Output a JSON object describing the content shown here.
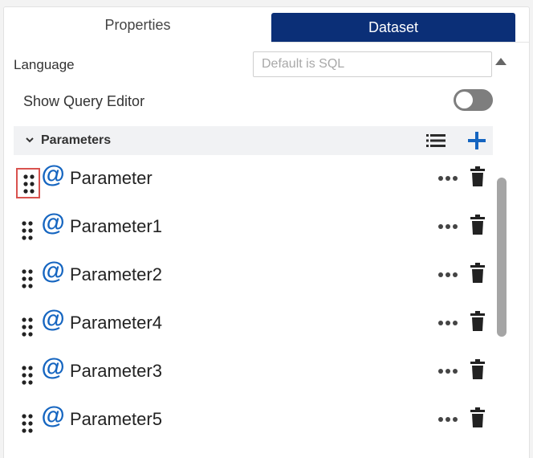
{
  "tabs": {
    "properties": "Properties",
    "dataset": "Dataset"
  },
  "language": {
    "label": "Language",
    "placeholder": "Default is SQL"
  },
  "query_editor": {
    "label": "Show Query Editor",
    "enabled": false
  },
  "parameters": {
    "title": "Parameters",
    "items": [
      {
        "name": "Parameter"
      },
      {
        "name": "Parameter1"
      },
      {
        "name": "Parameter2"
      },
      {
        "name": "Parameter4"
      },
      {
        "name": "Parameter3"
      },
      {
        "name": "Parameter5"
      }
    ]
  },
  "icons": {
    "at": "@",
    "drag": "drag-handle-icon",
    "more": "more-options-icon",
    "trash": "trash-icon",
    "list": "list-icon",
    "add": "plus-icon",
    "collapse": "chevron-down-icon",
    "scroll": "scroll-up-arrow"
  },
  "colors": {
    "accent": "#0b2f77",
    "at_icon": "#1565c0",
    "plus": "#1565c0",
    "selected_outline": "#d9534f"
  }
}
